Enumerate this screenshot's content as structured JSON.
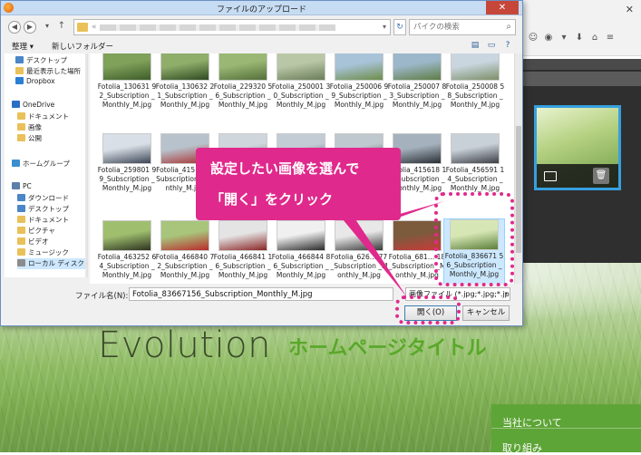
{
  "dialog": {
    "title": "ファイルのアップロード",
    "close_label": "✕",
    "address_prefix": "«",
    "search_placeholder": "パイクの検索",
    "toolbar": {
      "organize": "整理 ▾",
      "new_folder": "新しいフォルダー"
    }
  },
  "nav_pane": {
    "items": [
      {
        "label": "デスクトップ",
        "color": "#4a86c8"
      },
      {
        "label": "最近表示した場所",
        "color": "#e9c158"
      },
      {
        "label": "Dropbox",
        "color": "#2a7fd4"
      },
      {
        "label": "OneDrive",
        "color": "#2a6fc4"
      },
      {
        "label": "ドキュメント",
        "color": "#e9c158"
      },
      {
        "label": "画像",
        "color": "#e9c158"
      },
      {
        "label": "公開",
        "color": "#e9c158"
      },
      {
        "label": "ホームグループ",
        "color": "#3a8fd0"
      },
      {
        "label": "PC",
        "color": "#5b7fa8"
      },
      {
        "label": "ダウンロード",
        "color": "#4a86c8"
      },
      {
        "label": "デスクトップ",
        "color": "#4a86c8"
      },
      {
        "label": "ドキュメント",
        "color": "#e9c158"
      },
      {
        "label": "ピクチャ",
        "color": "#e9c158"
      },
      {
        "label": "ビデオ",
        "color": "#e9c158"
      },
      {
        "label": "ミュージック",
        "color": "#e9c158"
      },
      {
        "label": "ローカル ディスク (C",
        "color": "#8c8c8c"
      }
    ]
  },
  "files": [
    {
      "name": "Fotolia_130631 92_Subscription _Monthly_M.jpg",
      "c1": "#7fa15a",
      "c2": "#3d5d2a"
    },
    {
      "name": "Fotolia_130632 21_Subscription _Monthly_M.jpg",
      "c1": "#8fae6a",
      "c2": "#2f4a22"
    },
    {
      "name": "Fotolia_229320 56_Subscription _Monthly_M.jpg",
      "c1": "#9ab874",
      "c2": "#546f3a"
    },
    {
      "name": "Fotolia_250001 30_Subscription _Monthly_M.jpg",
      "c1": "#b9c7a6",
      "c2": "#6a7d58"
    },
    {
      "name": "Fotolia_250006 99_Subscription _Monthly_M.jpg",
      "c1": "#a8c3d8",
      "c2": "#6e8d4a"
    },
    {
      "name": "Fotolia_250007 83_Subscription _Monthly_M.jpg",
      "c1": "#9cb7c9",
      "c2": "#5f7d45"
    },
    {
      "name": "Fotolia_250008 58_Subscription _Monthly_M.jpg",
      "c1": "#c9d6e0",
      "c2": "#7d8f68"
    },
    {
      "name": "Fotolia_259801 99_Subscription _Monthly_M.jpg",
      "c1": "#d9dfe6",
      "c2": "#3c4756"
    },
    {
      "name": "Fotolia_415…76_Subscription _Monthly_M.jpg",
      "c1": "#b8c2cc",
      "c2": "#a83232"
    },
    {
      "name": "",
      "c1": "#cfd6dc",
      "c2": "#6f7884"
    },
    {
      "name": "",
      "c1": "#c3ccd4",
      "c2": "#5a626c"
    },
    {
      "name": "",
      "c1": "#bfc8cf",
      "c2": "#3c434c"
    },
    {
      "name": "Fotolia_415618 12_Subscription _Monthly_M.jpg",
      "c1": "#a5b2bd",
      "c2": "#2b2f36"
    },
    {
      "name": "Fotolia_456591 14_Subscription _Monthly_M.jpg",
      "c1": "#c9d1d8",
      "c2": "#3c3f45"
    },
    {
      "name": "Fotolia_463252 64_Subscription _Monthly_M.jpg",
      "c1": "#9fbf6f",
      "c2": "#2d3320"
    },
    {
      "name": "Fotolia_466840 72_Subscription _Monthly_M.jpg",
      "c1": "#a8c57b",
      "c2": "#b82c2c"
    },
    {
      "name": "Fotolia_466841 16_Subscription _Monthly_M.jpg",
      "c1": "#e4e4e4",
      "c2": "#8a2424"
    },
    {
      "name": "Fotolia_466844 86_Subscription _Monthly_M.jpg",
      "c1": "#f0f0f0",
      "c2": "#2a2a2a"
    },
    {
      "name": "Fotolia_626… 77_Subscription _Monthly_M.jpg",
      "c1": "#e8e8e8",
      "c2": "#3a3a3a"
    },
    {
      "name": "Fotolia_681… 18_Subscription _Monthly_M.jpg",
      "c1": "#7c5b3c",
      "c2": "#c83a3a"
    },
    {
      "name": "Fotolia_836671 56_Subscription _Monthly_M.jpg",
      "c1": "#d6e7b5",
      "c2": "#5b7f3a"
    }
  ],
  "bottom": {
    "filename_label": "ファイル名(N):",
    "filename_value": "Fotolia_83667156_Subscription_Monthly_M.jpg",
    "type_value": "画像ファイル (*.jpg;*.jpg;*.jpe",
    "open_label": "開く(O)",
    "cancel_label": "キャンセル"
  },
  "callout": {
    "line1": "設定したい画像を選んで",
    "line2": "「開く」をクリック",
    "color": "#e0298c"
  },
  "page": {
    "logo": "Evolution",
    "site_title": "ホームページタイトル",
    "nav": [
      "当社について",
      "取り組み"
    ]
  }
}
